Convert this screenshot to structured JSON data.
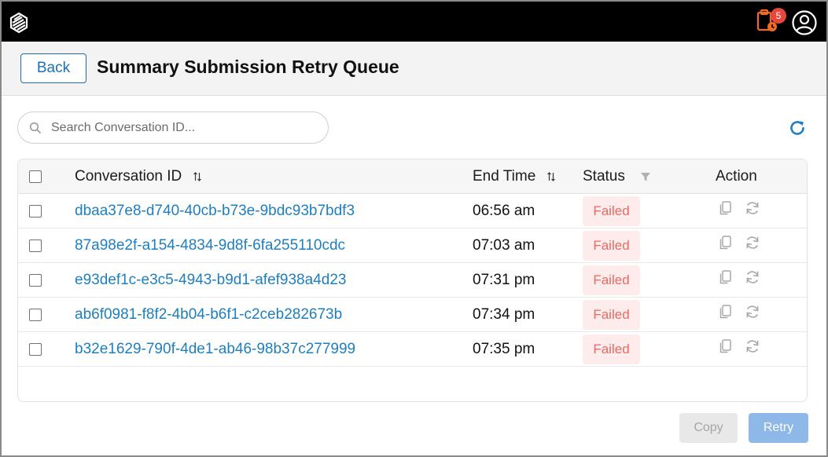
{
  "topbar": {
    "notification_count": "5"
  },
  "header": {
    "back_label": "Back",
    "title": "Summary Submission Retry Queue"
  },
  "search": {
    "placeholder": "Search Conversation ID..."
  },
  "table": {
    "columns": {
      "conversation_id": "Conversation ID",
      "end_time": "End Time",
      "status": "Status",
      "action": "Action"
    },
    "rows": [
      {
        "id": "dbaa37e8-d740-40cb-b73e-9bdc93b7bdf3",
        "end_time": "06:56 am",
        "status": "Failed"
      },
      {
        "id": "87a98e2f-a154-4834-9d8f-6fa255110cdc",
        "end_time": "07:03 am",
        "status": "Failed"
      },
      {
        "id": "e93def1c-e3c5-4943-b9d1-afef938a4d23",
        "end_time": "07:31 pm",
        "status": "Failed"
      },
      {
        "id": "ab6f0981-f8f2-4b04-b6f1-c2ceb282673b",
        "end_time": "07:34 pm",
        "status": "Failed"
      },
      {
        "id": "b32e1629-790f-4de1-ab46-98b37c277999",
        "end_time": "07:35 pm",
        "status": "Failed"
      }
    ]
  },
  "footer": {
    "copy_label": "Copy",
    "retry_label": "Retry"
  },
  "colors": {
    "topbar": "#000000",
    "accent": "#1e6fb0",
    "link": "#1e7fc0",
    "notification_icon": "#f06a23",
    "badge": "#e8473d",
    "failed_text": "#e86a63",
    "failed_bg": "#fdeceb",
    "retry_button": "#8db8e8"
  },
  "icons": [
    "app-logo-icon",
    "clipboard-clock-icon",
    "user-circle-icon",
    "search-icon",
    "refresh-icon",
    "sort-icon",
    "filter-icon",
    "copy-icon",
    "retry-icon"
  ]
}
